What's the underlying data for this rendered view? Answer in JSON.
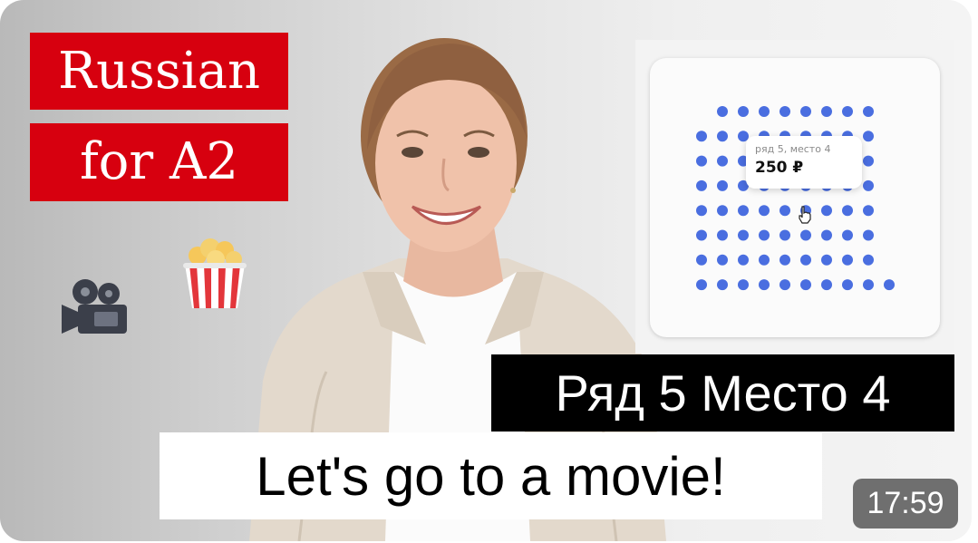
{
  "thumbnail": {
    "title_line_1": "Russian",
    "title_line_2": "for A2",
    "caption_russian": "Ряд 5 Место 4",
    "caption_english": "Let's go to a movie!",
    "duration": "17:59",
    "badge_color": "#d7000f",
    "seat_color": "#4a6ee0"
  },
  "icons": {
    "camera": "movie-camera-icon",
    "popcorn": "popcorn-icon",
    "cursor": "hand-pointer-icon"
  },
  "seat_map": {
    "tooltip_seat": "ряд 5, место 4",
    "tooltip_price": "250 ₽"
  }
}
